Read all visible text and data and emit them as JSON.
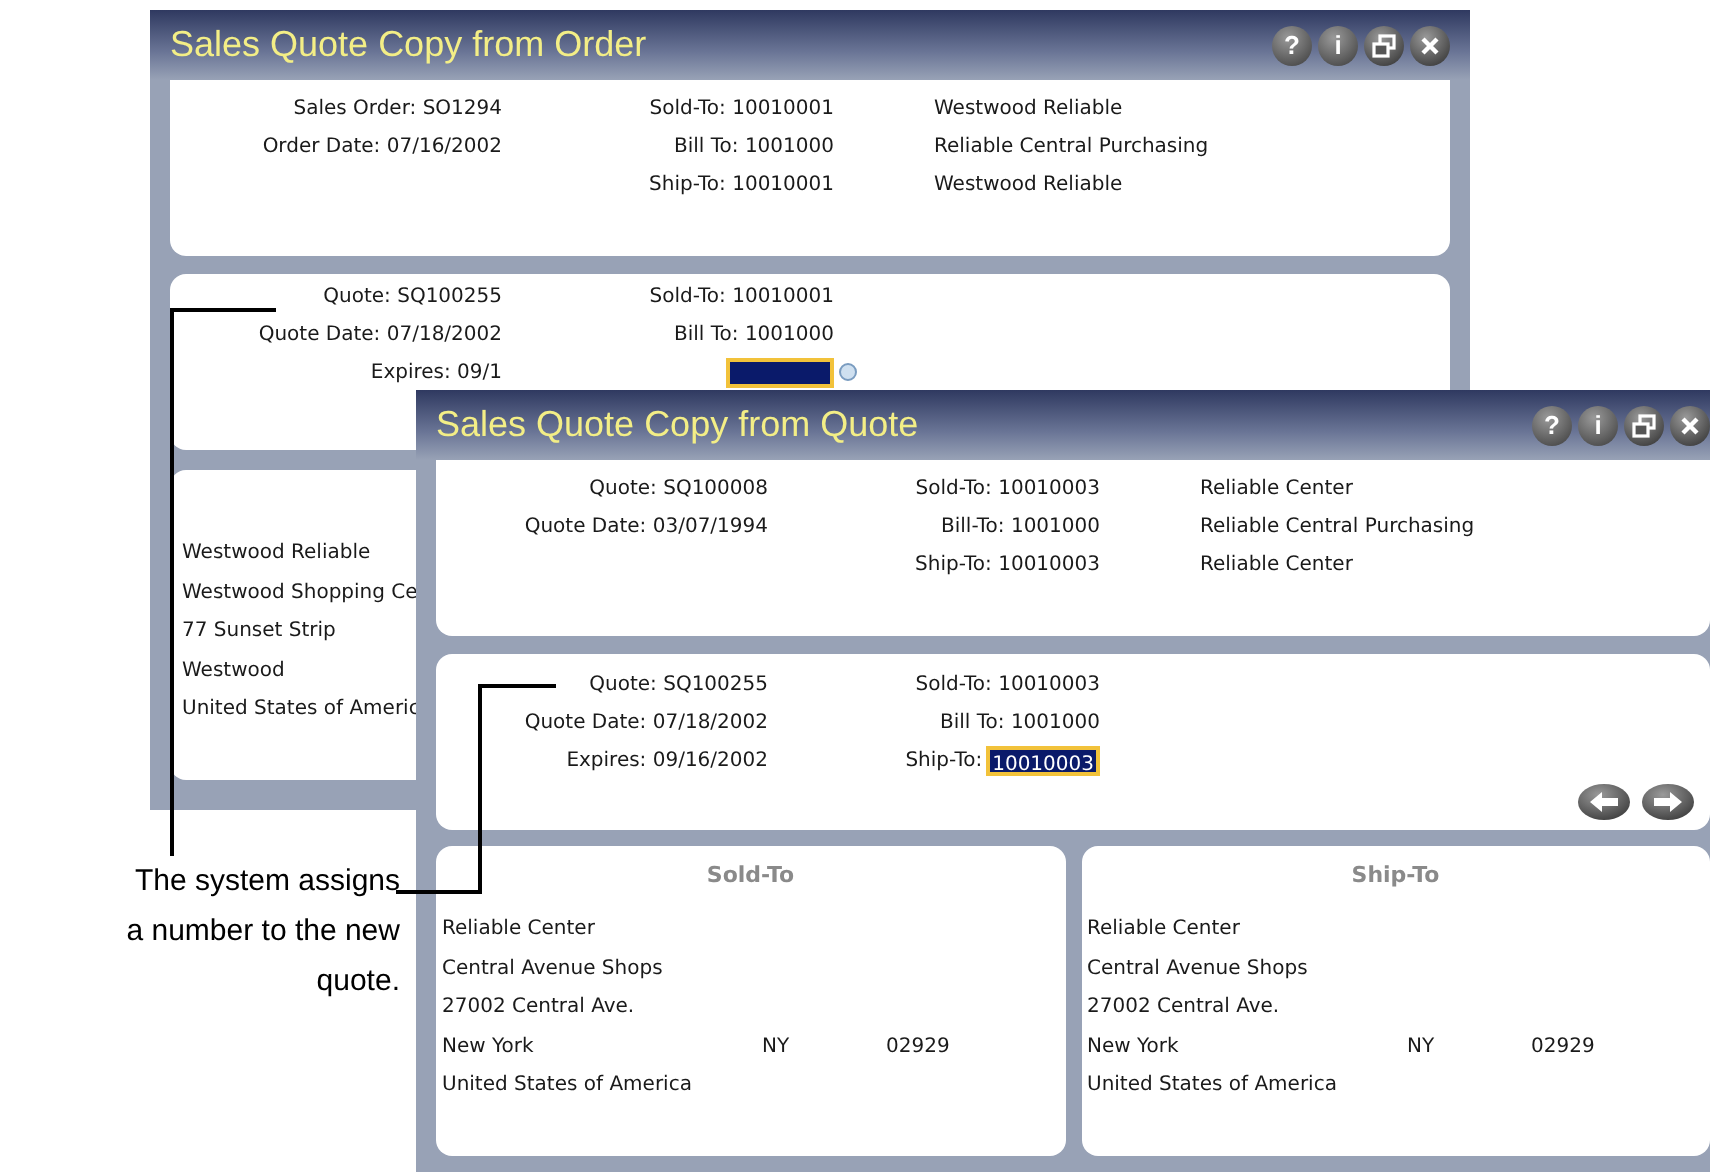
{
  "windows": [
    {
      "title": "Sales Quote Copy from Order",
      "controls": [
        {
          "kind": "help",
          "label": "?"
        },
        {
          "kind": "info",
          "label": "i"
        },
        {
          "kind": "restore"
        },
        {
          "kind": "close"
        }
      ],
      "header": {
        "col1": [
          "Sales Order: SO1294",
          "Order Date: 07/16/2002"
        ],
        "col2": [
          "Sold-To: 10010001",
          "Bill To: 1001000",
          "Ship-To: 10010001"
        ],
        "col3": [
          "Westwood Reliable",
          "Reliable Central Purchasing",
          "Westwood Reliable"
        ]
      },
      "quote": {
        "col1": [
          "Quote: SQ100255",
          "Quote Date: 07/18/2002",
          "Expires: 09/1"
        ],
        "col2": [
          "Sold-To: 10010001",
          "Bill To: 1001000"
        ],
        "ship_to": {
          "selected": true
        }
      },
      "addresses": [
        {
          "rows": [
            [
              "Westwood Reliable"
            ],
            [
              "Westwood Shopping Ce"
            ],
            [
              "77 Sunset Strip"
            ],
            [
              "Westwood"
            ],
            [
              "United States of Americ"
            ]
          ]
        }
      ]
    },
    {
      "title": "Sales Quote Copy from Quote",
      "controls": [
        {
          "kind": "help",
          "label": "?"
        },
        {
          "kind": "info",
          "label": "i"
        },
        {
          "kind": "restore"
        },
        {
          "kind": "close"
        }
      ],
      "header": {
        "col1": [
          "Quote: SQ100008",
          "Quote Date: 03/07/1994"
        ],
        "col2": [
          "Sold-To: 10010003",
          "Bill-To: 1001000",
          "Ship-To: 10010003"
        ],
        "col3": [
          "Reliable Center",
          "Reliable Central Purchasing",
          "Reliable Center"
        ]
      },
      "quote": {
        "col1": [
          "Quote: SQ100255",
          "Quote Date: 07/18/2002",
          "Expires: 09/16/2002"
        ],
        "col2": [
          "Sold-To: 10010003",
          "Bill To: 1001000"
        ],
        "ship_to": {
          "label": "Ship-To:",
          "value": "10010003",
          "selected": true
        }
      },
      "addresses": [
        {
          "heading": "Sold-To",
          "rows": [
            [
              "Reliable Center"
            ],
            [
              "Central Avenue Shops"
            ],
            [
              "27002 Central Ave."
            ],
            [
              "New York",
              "NY",
              "02929"
            ],
            [
              "United States of America"
            ]
          ]
        },
        {
          "heading": "Ship-To",
          "rows": [
            [
              "Reliable Center"
            ],
            [
              "Central Avenue Shops"
            ],
            [
              "27002 Central Ave."
            ],
            [
              "New York",
              "NY",
              "02929"
            ],
            [
              "United States of America"
            ]
          ]
        }
      ]
    }
  ],
  "callout": "The system assigns\na number to the new\nquote."
}
